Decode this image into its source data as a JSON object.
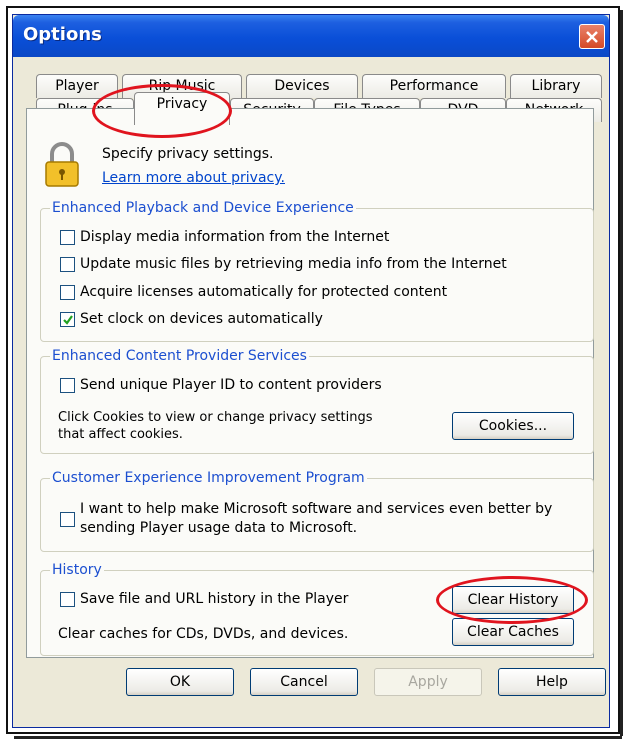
{
  "window": {
    "title": "Options"
  },
  "tabs_row1": [
    "Player",
    "Rip Music",
    "Devices",
    "Performance",
    "Library"
  ],
  "tabs_row2": [
    "Plug-ins",
    "Privacy",
    "Security",
    "File Types",
    "DVD",
    "Network"
  ],
  "active_tab": "Privacy",
  "header": {
    "specify": "Specify privacy settings.",
    "learn_more": "Learn more about privacy."
  },
  "groups": {
    "playback": {
      "legend": "Enhanced Playback and Device Experience",
      "items": [
        {
          "label": "Display media information from the Internet",
          "checked": false
        },
        {
          "label": "Update music files by retrieving media info from the Internet",
          "checked": false
        },
        {
          "label": "Acquire licenses automatically for protected content",
          "checked": false
        },
        {
          "label": "Set clock on devices automatically",
          "checked": true
        }
      ]
    },
    "content": {
      "legend": "Enhanced Content Provider Services",
      "send_id": {
        "label": "Send unique Player ID to content providers",
        "checked": false
      },
      "cookies_text_line1": "Click Cookies to view or change privacy settings",
      "cookies_text_line2": "that affect cookies.",
      "cookies_button": "Cookies..."
    },
    "ceip": {
      "legend": "Customer Experience Improvement Program",
      "line1": "I want to help make Microsoft software and services even better by",
      "line2": "sending Player usage data to Microsoft.",
      "checked": false
    },
    "history": {
      "legend": "History",
      "save": {
        "label": "Save file and URL history in the Player",
        "checked": false
      },
      "clear_history_button": "Clear History",
      "caches_text": "Clear caches for CDs, DVDs, and devices.",
      "clear_caches_button": "Clear Caches"
    }
  },
  "footer": {
    "ok": "OK",
    "cancel": "Cancel",
    "apply": "Apply",
    "help": "Help"
  },
  "colors": {
    "highlight_ring": "#e0141e",
    "legend_text": "#1c4fd0",
    "titlebar": "#0a4fd8"
  }
}
